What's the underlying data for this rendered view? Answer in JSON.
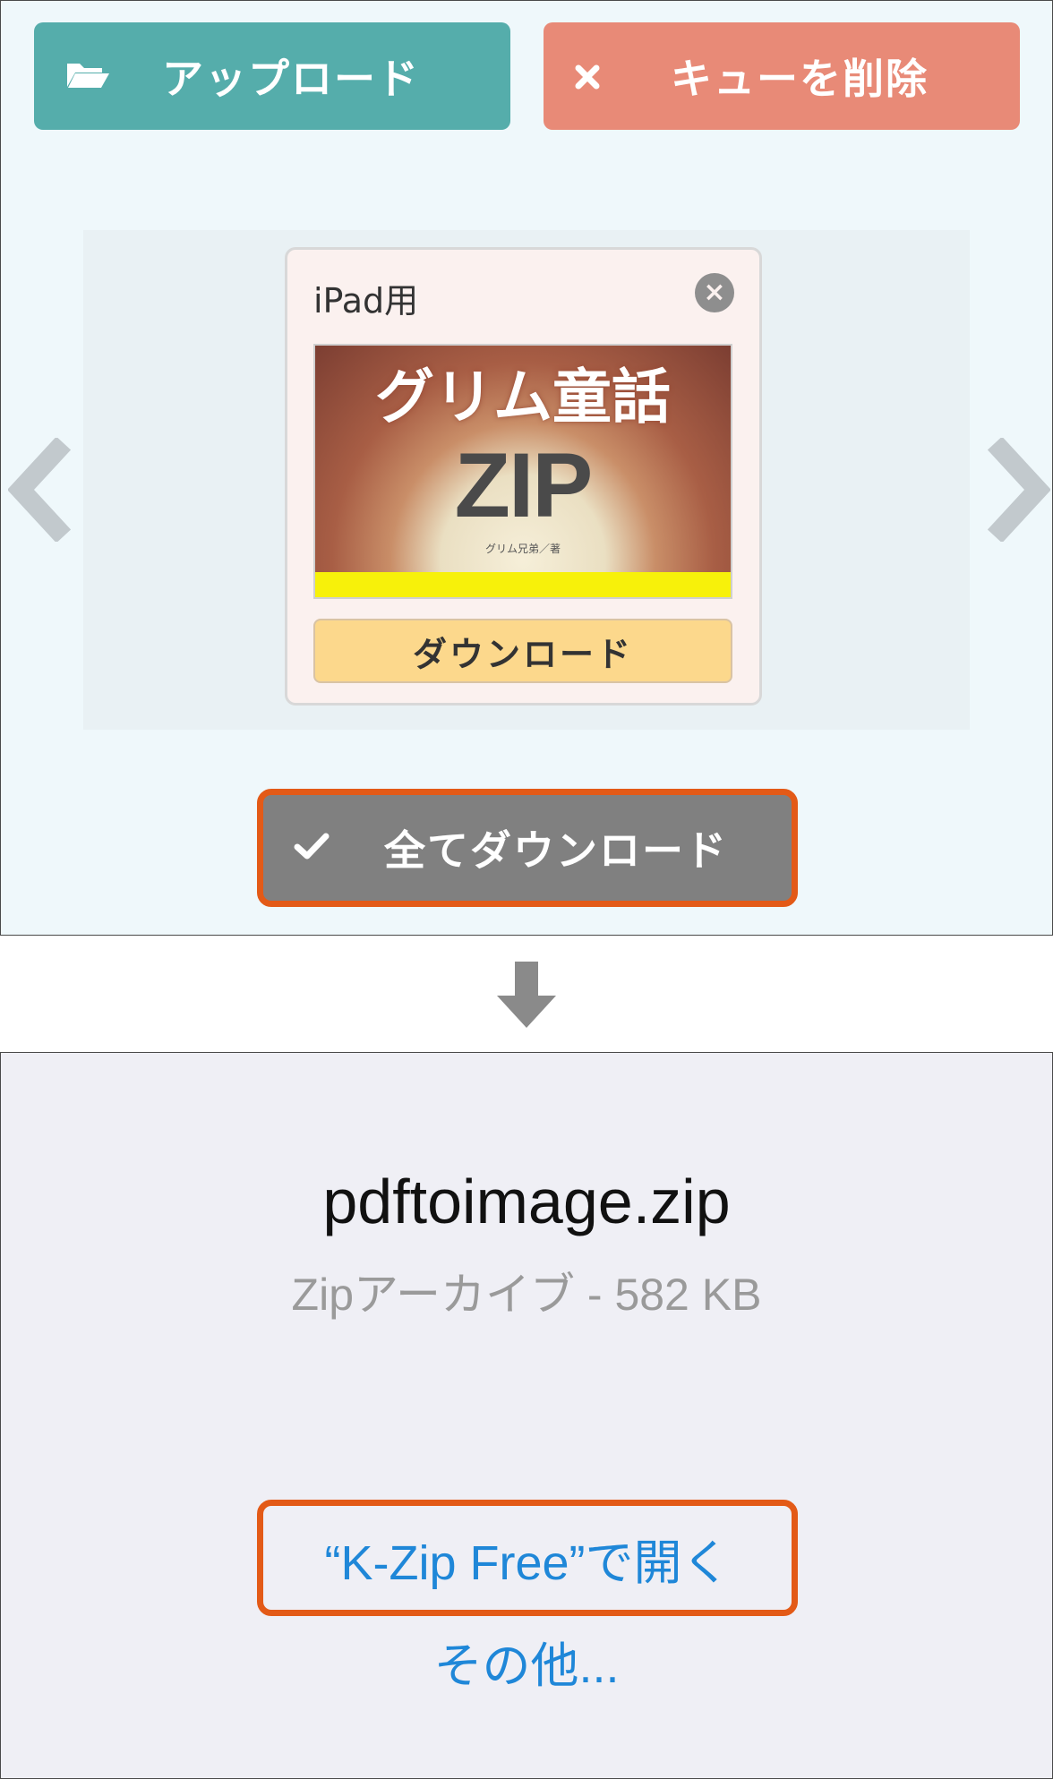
{
  "top": {
    "upload_label": "アップロード",
    "clear_queue_label": "キューを削除",
    "card": {
      "title": "iPad用",
      "thumbnail_title": "グリム童話",
      "thumbnail_zip": "ZIP",
      "thumbnail_author": "グリム兄弟／著",
      "download_label": "ダウンロード"
    },
    "download_all_label": "全てダウンロード",
    "colors": {
      "upload": "#55adab",
      "clear": "#e88a77",
      "download_all": "#808080",
      "highlight": "#e35a17"
    }
  },
  "bottom": {
    "file_name": "pdftoimage.zip",
    "file_meta": "Zipアーカイブ - 582 KB",
    "open_in_label": "“K-Zip Free”で開く",
    "other_label": "その他..."
  }
}
